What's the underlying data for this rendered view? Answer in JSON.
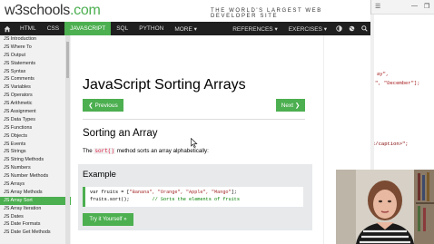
{
  "brand": {
    "logo_main": "w3schools",
    "logo_dot": ".com",
    "tagline": "THE WORLD'S LARGEST WEB DEVELOPER SITE"
  },
  "nav": {
    "items": [
      "HTML",
      "CSS",
      "JAVASCRIPT",
      "SQL",
      "PYTHON",
      "MORE ▾"
    ],
    "active_index": 2,
    "right_items": [
      "REFERENCES ▾",
      "EXERCISES ▾"
    ],
    "icons": [
      "contrast-icon",
      "globe-icon",
      "search-icon"
    ]
  },
  "sidebar": {
    "items": [
      "JS Introduction",
      "JS Where To",
      "JS Output",
      "JS Statements",
      "JS Syntax",
      "JS Comments",
      "JS Variables",
      "JS Operators",
      "JS Arithmetic",
      "JS Assignment",
      "JS Data Types",
      "JS Functions",
      "JS Objects",
      "JS Events",
      "JS Strings",
      "JS String Methods",
      "JS Numbers",
      "JS Number Methods",
      "JS Arrays",
      "JS Array Methods",
      "JS Array Sort",
      "JS Array Iteration",
      "JS Dates",
      "JS Date Formats",
      "JS Date Get Methods"
    ],
    "active_index": 20
  },
  "main": {
    "title": "JavaScript Sorting Arrays",
    "prev_label": "❮ Previous",
    "next_label": "Next ❯",
    "section_title": "Sorting an Array",
    "desc_before": "The ",
    "desc_code": "sort()",
    "desc_after": " method sorts an array alphabetically:",
    "example": {
      "title": "Example",
      "code_line1_a": "var fruits = [",
      "code_line1_b": "\"Banana\", \"Orange\", \"Apple\", \"Mango\"",
      "code_line1_c": "];",
      "code_line2_a": "fruits.sort();        ",
      "code_line2_b": "// Sorts the elements of fruits",
      "try_label": "Try it Yourself »"
    }
  },
  "editor": {
    "line1": "ay\",",
    "line2": "\", \"December\"];",
    "line3": "</caption>\";"
  },
  "colors": {
    "accent": "#4CAF50",
    "nav_bg": "#1f1f1f",
    "sidebar_bg": "#f1f1f1",
    "example_bg": "#e7e9eb"
  }
}
